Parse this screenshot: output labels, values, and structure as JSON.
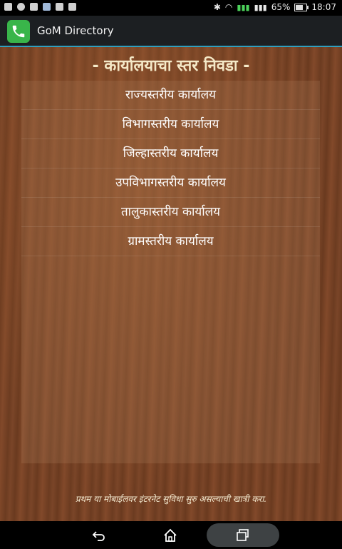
{
  "status_bar": {
    "battery_percent": "65%",
    "battery_level": 0.65,
    "time": "18:07",
    "left_icons": [
      "facebook-icon",
      "whatsapp-icon",
      "message-icon",
      "image-icon",
      "mail-icon",
      "check-icon"
    ],
    "right_icons": [
      "bluetooth-icon",
      "wifi-icon",
      "signal-icon",
      "signal-icon",
      "battery-icon"
    ]
  },
  "app_bar": {
    "title": "GoM Directory",
    "icon": "phone-icon"
  },
  "main": {
    "heading": "- कार्यालयाचा स्तर निवडा -",
    "items": [
      {
        "label": "राज्यस्तरीय कार्यालय"
      },
      {
        "label": "विभागस्तरीय कार्यालय"
      },
      {
        "label": "जिल्हास्तरीय कार्यालय"
      },
      {
        "label": "उपविभागस्तरीय कार्यालय"
      },
      {
        "label": "तालुकास्तरीय कार्यालय"
      },
      {
        "label": "ग्रामस्तरीय कार्यालय"
      }
    ],
    "footnote": "प्रथम या मोबाईलवर इंटरनेट सुविधा सुरु असल्याची खात्री करा."
  },
  "nav_bar": {
    "back_icon": "back-icon",
    "home_icon": "home-icon",
    "recents_icon": "recents-icon"
  },
  "colors": {
    "app_bar_bg": "#1c1f22",
    "app_bar_accent": "#2f9fbf",
    "app_icon_green": "#39b54a",
    "heading_text": "#f5e9c8"
  }
}
